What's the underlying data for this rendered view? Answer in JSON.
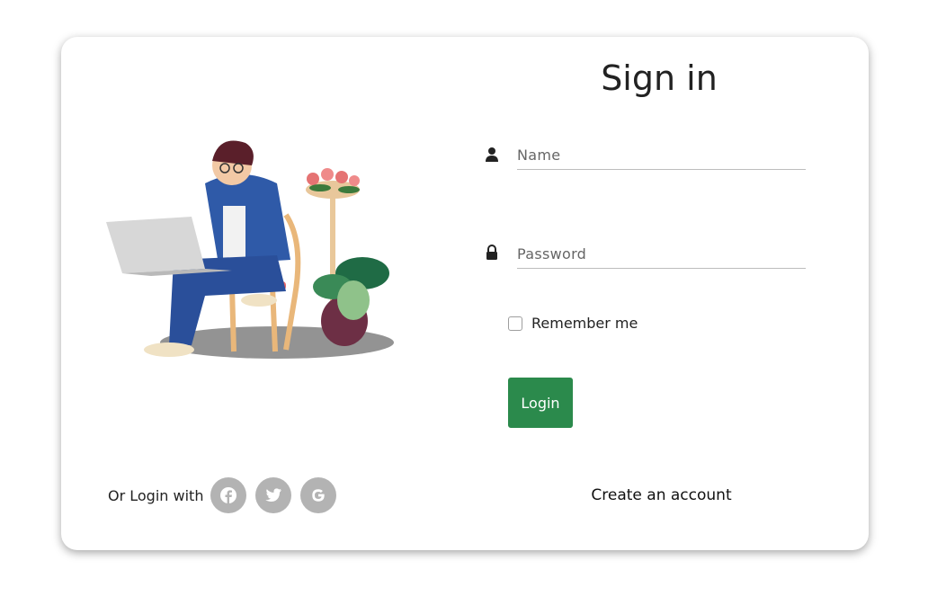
{
  "form": {
    "title": "Sign in",
    "name_placeholder": "Name",
    "password_placeholder": "Password",
    "remember_label": "Remember me",
    "login_label": "Login",
    "or_login_with": "Or Login with",
    "create_account": "Create an account"
  },
  "icons": {
    "name": "user-icon",
    "password": "lock-icon",
    "social": [
      "facebook-icon",
      "twitter-icon",
      "google-icon"
    ]
  },
  "colors": {
    "login_button": "#2b8a4c",
    "social_buttons": "#b3b3b3"
  },
  "remember_checked": false
}
